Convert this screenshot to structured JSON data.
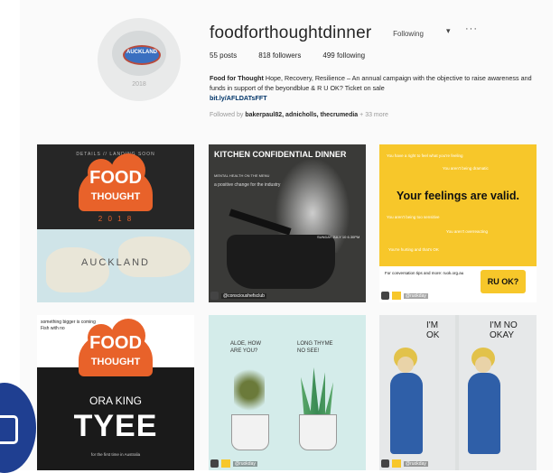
{
  "profile": {
    "username": "foodforthoughtdinner",
    "follow_label": "Following",
    "dropdown_glyph": "▾",
    "more_glyph": "···",
    "stats": {
      "posts": "55 posts",
      "followers": "818 followers",
      "following": "499 following"
    },
    "bio": {
      "name": "Food for Thought",
      "text": "Hope, Recovery, Resilience – An annual campaign with the objective to raise awareness and funds in support of the beyondblue & R U OK? Ticket on sale",
      "link": "bit.ly/AFLDATsFFT"
    },
    "followed_by": {
      "prefix": "Followed by",
      "names": "bakerpaul82, adnicholls, thecrumedia",
      "suffix": "+ 33 more"
    },
    "avatar": {
      "label": "AUCKLAND",
      "year": "2018"
    }
  },
  "posts": {
    "p1": {
      "top": "DETAILS // LANDING SOON",
      "w1": "FOOD",
      "w2": "THOUGHT",
      "year": "2 0 1 8",
      "city": "AUCKLAND"
    },
    "p2": {
      "title": "KITCHEN CONFIDENTIAL DINNER",
      "sub1": "MENTAL HEALTH ON THE MENU",
      "sub2": "a positive change for the industry",
      "date": "SUNDAY JULY 10 6.30PM",
      "tag": "@conscioushefsclub"
    },
    "p3": {
      "l1": "You have a right to feel what you're feeling",
      "l2": "You aren't being dramatic",
      "headline": "Your feelings are valid.",
      "l3": "You aren't being too sensitive",
      "l4": "You aren't overreacting",
      "l5": "You're hurting and that's OK",
      "foot": "For conversation tips and more: ruok.org.au",
      "badge": "RU OK?",
      "tag": "@ruokday"
    },
    "p4": {
      "small": "something bigger is coming\nFish with no",
      "w1": "FOOD",
      "w2": "THOUGHT",
      "ora": "ORA KING",
      "tyee": "TYEE",
      "first": "for the first time in Australia"
    },
    "p5": {
      "q1": "ALOE, HOW\nARE YOU?",
      "q2": "LONG THYME\nNO SEE!",
      "tag": "@ruokday"
    },
    "p6": {
      "t1": "I'M\nOK",
      "t2": "I'M NO\nOKAY",
      "tag": "@ruokday"
    }
  }
}
